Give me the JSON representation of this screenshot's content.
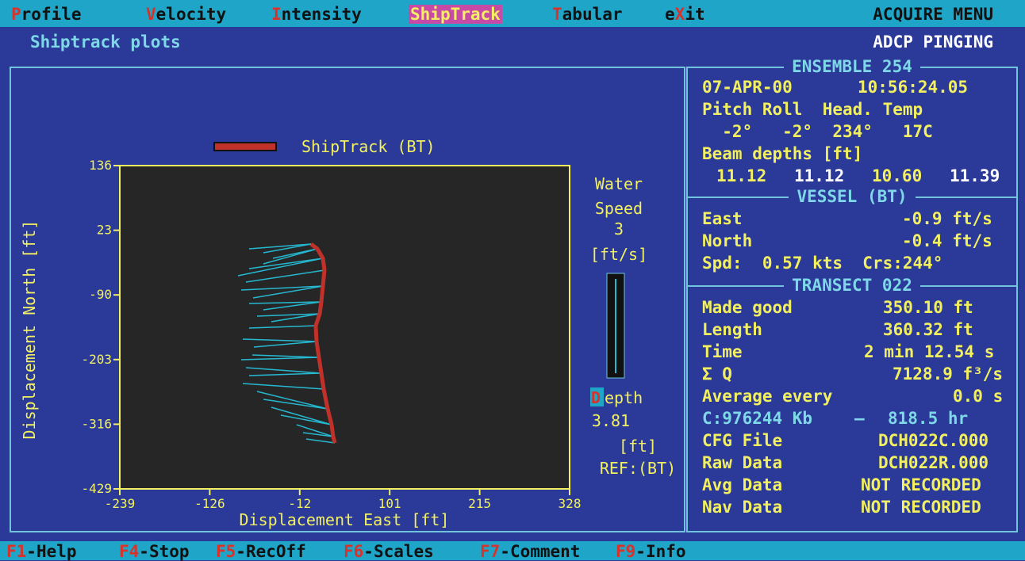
{
  "menu": {
    "items": [
      {
        "hotkey": "P",
        "rest": "rofile",
        "x": 14
      },
      {
        "hotkey": "V",
        "rest": "elocity",
        "x": 184
      },
      {
        "hotkey": "I",
        "rest": "ntensity",
        "x": 342
      },
      {
        "hotkey": "S",
        "rest": "hipTrack",
        "x": 517,
        "active": true
      },
      {
        "hotkey": "T",
        "rest": "abular",
        "x": 696
      },
      {
        "hotkey": "e",
        "rest": "X",
        "rest2": "it",
        "x": 838
      }
    ],
    "title": "ACQUIRE MENU"
  },
  "subtitle": "Shiptrack plots",
  "status_label": "ADCP PINGING",
  "plot": {
    "legend": "ShipTrack (BT)",
    "xlabel": "Displacement East [ft]",
    "ylabel": "Displacement North [ft]",
    "xticks": [
      "-239",
      "-126",
      "-12",
      "101",
      "215",
      "328"
    ],
    "yticks": [
      "136",
      "23",
      "-90",
      "-203",
      "-316",
      "-429"
    ],
    "water_label1": "Water",
    "water_label2": "Speed",
    "water_value": "3",
    "water_unit": "[ft/s]",
    "depth_hotkey": "D",
    "depth_rest": "epth",
    "depth_value": "3.81",
    "depth_unit": "[ft]",
    "ref": "REF:(BT)"
  },
  "ensemble": {
    "header": "ENSEMBLE 254",
    "date": "07-APR-00",
    "time": "10:56:24.05",
    "cols": "Pitch Roll  Head. Temp",
    "vals": "  -2°   -2°  234°   17C",
    "beam_label": "Beam depths [ft]",
    "beams": [
      "11.12",
      "11.12",
      "10.60",
      "11.39"
    ]
  },
  "vessel": {
    "header": "VESSEL (BT)",
    "east_label": "East",
    "east_val": "-0.9 ft/s",
    "north_label": "North",
    "north_val": "-0.4 ft/s",
    "spd": "Spd:  0.57 kts  Crs:244°"
  },
  "transect": {
    "header": "TRANSECT  022",
    "rows": [
      {
        "label": "Made good",
        "value": "350.10 ft"
      },
      {
        "label": "Length",
        "value": "360.32 ft"
      },
      {
        "label": "Time",
        "value": "2 min 12.54 s"
      },
      {
        "label": "Σ Q",
        "value": "7128.9 f³/s"
      },
      {
        "label": "Average every",
        "value": "0.0 s"
      }
    ],
    "disk": "C:976244 Kb",
    "hours": "818.5 hr",
    "files": [
      {
        "label": "CFG File",
        "value": "DCH022C.000"
      },
      {
        "label": "Raw Data",
        "value": "DCH022R.000"
      },
      {
        "label": "Avg Data",
        "value": "NOT RECORDED"
      },
      {
        "label": "Nav Data",
        "value": "NOT RECORDED"
      }
    ]
  },
  "fkeys": [
    {
      "key": "F1",
      "label": "-Help",
      "x": 8
    },
    {
      "key": "F4",
      "label": "-Stop",
      "x": 150
    },
    {
      "key": "F5",
      "label": "-RecOff",
      "x": 272
    },
    {
      "key": "F6",
      "label": "-Scales",
      "x": 433
    },
    {
      "key": "F7",
      "label": "-Comment",
      "x": 605
    },
    {
      "key": "F9",
      "label": "-Info",
      "x": 776
    }
  ],
  "colors": {
    "bg": "#2b3a98",
    "cyan": "#1ea5c8",
    "track": "#c0312a",
    "stick": "#25b8d0",
    "yellow": "#f2f060"
  }
}
